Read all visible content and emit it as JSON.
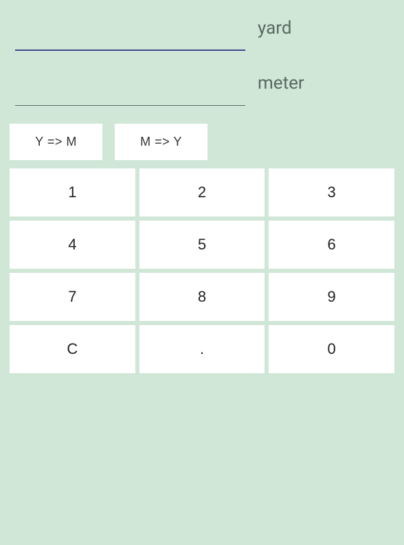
{
  "inputs": {
    "yard": {
      "value": "",
      "unit": "yard"
    },
    "meter": {
      "value": "",
      "unit": "meter"
    }
  },
  "convert": {
    "yToM": "Y => M",
    "mToY": "M => Y"
  },
  "keypad": {
    "k1": "1",
    "k2": "2",
    "k3": "3",
    "k4": "4",
    "k5": "5",
    "k6": "6",
    "k7": "7",
    "k8": "8",
    "k9": "9",
    "kC": "C",
    "kDot": ".",
    "k0": "0"
  }
}
